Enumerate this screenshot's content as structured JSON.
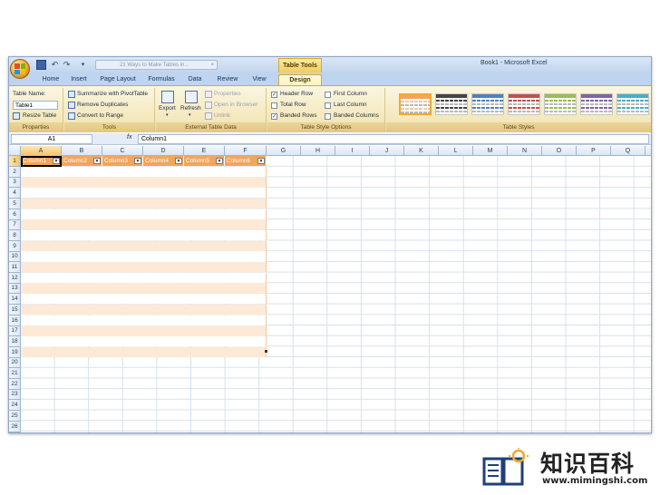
{
  "window": {
    "title": "Book1 - Microsoft Excel",
    "doc_tab": "21 Ways to Make Tables in...",
    "contextual_header": "Table Tools"
  },
  "tabs": [
    "Home",
    "Insert",
    "Page Layout",
    "Formulas",
    "Data",
    "Review",
    "View",
    "Design"
  ],
  "active_tab": "Design",
  "ribbon": {
    "properties": {
      "table_name_label": "Table Name:",
      "table_name_value": "Table1",
      "resize_table": "Resize Table",
      "caption": "Properties"
    },
    "tools": {
      "summarize": "Summarize with PivotTable",
      "remove_duplicates": "Remove Duplicates",
      "convert_to_range": "Convert to Range",
      "caption": "Tools"
    },
    "external": {
      "export": "Export",
      "refresh": "Refresh",
      "properties": "Properties",
      "open_in_browser": "Open in Browser",
      "unlink": "Unlink",
      "caption": "External Table Data"
    },
    "style_options": {
      "header_row": "Header Row",
      "total_row": "Total Row",
      "banded_rows": "Banded Rows",
      "first_column": "First Column",
      "last_column": "Last Column",
      "banded_columns": "Banded Columns",
      "caption": "Table Style Options"
    },
    "table_styles": {
      "caption": "Table Styles"
    }
  },
  "formula_bar": {
    "name_box": "A1",
    "fx": "fx",
    "value": "Column1"
  },
  "columns": [
    "A",
    "B",
    "C",
    "D",
    "E",
    "F",
    "G",
    "H",
    "I",
    "J",
    "K",
    "L",
    "M",
    "N",
    "O",
    "P",
    "Q"
  ],
  "rows": [
    "1",
    "2",
    "3",
    "4",
    "5",
    "6",
    "7",
    "8",
    "9",
    "10",
    "11",
    "12",
    "13",
    "14",
    "15",
    "16",
    "17",
    "18",
    "19",
    "20",
    "21",
    "22",
    "23",
    "24",
    "25",
    "26"
  ],
  "table_headers": [
    "Column1",
    "Column2",
    "Column3",
    "Column4",
    "Column5",
    "Column6"
  ],
  "colors": {
    "table_header": "#f2a65a",
    "band_light": "#fde9d6",
    "band_white": "#ffffff",
    "ribbon_accent": "#f3e6b8"
  },
  "watermark": {
    "text": "知识百科",
    "url": "www.mimingshi.com"
  }
}
